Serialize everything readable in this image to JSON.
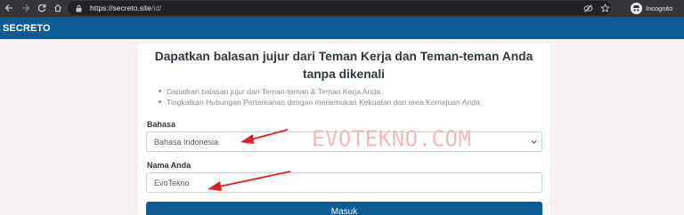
{
  "browser": {
    "url_host": "https://secreto.site",
    "url_path": "/id/",
    "incognito_label": "Incognito",
    "nav_icons": [
      "back-icon",
      "forward-icon",
      "reload-icon",
      "home-icon"
    ],
    "omnibox_icons": [
      "eye-off-icon",
      "star-icon"
    ]
  },
  "site": {
    "logo": "SECRETO",
    "brand_color": "#0c5c95"
  },
  "card": {
    "title_line1": "Dapatkan balasan jujur dari Teman Kerja dan Teman-teman Anda",
    "title_line2": "tanpa dikenali",
    "benefits": [
      "Dapatkan balasan jujur dari Teman-teman & Teman Kerja Anda.",
      "Tingkatkan Hubungan Pertemanan dengan menemukan Kekuatan dan area Kemajuan Anda"
    ]
  },
  "form": {
    "language_label": "Bahasa",
    "language_value": "Bahasa Indonesia",
    "name_label": "Nama Anda",
    "name_value": "EvoTekno",
    "submit_label": "Masuk"
  },
  "overlay": {
    "watermark": "EVOTEKNO.COM",
    "arrow_color": "#e02020"
  }
}
